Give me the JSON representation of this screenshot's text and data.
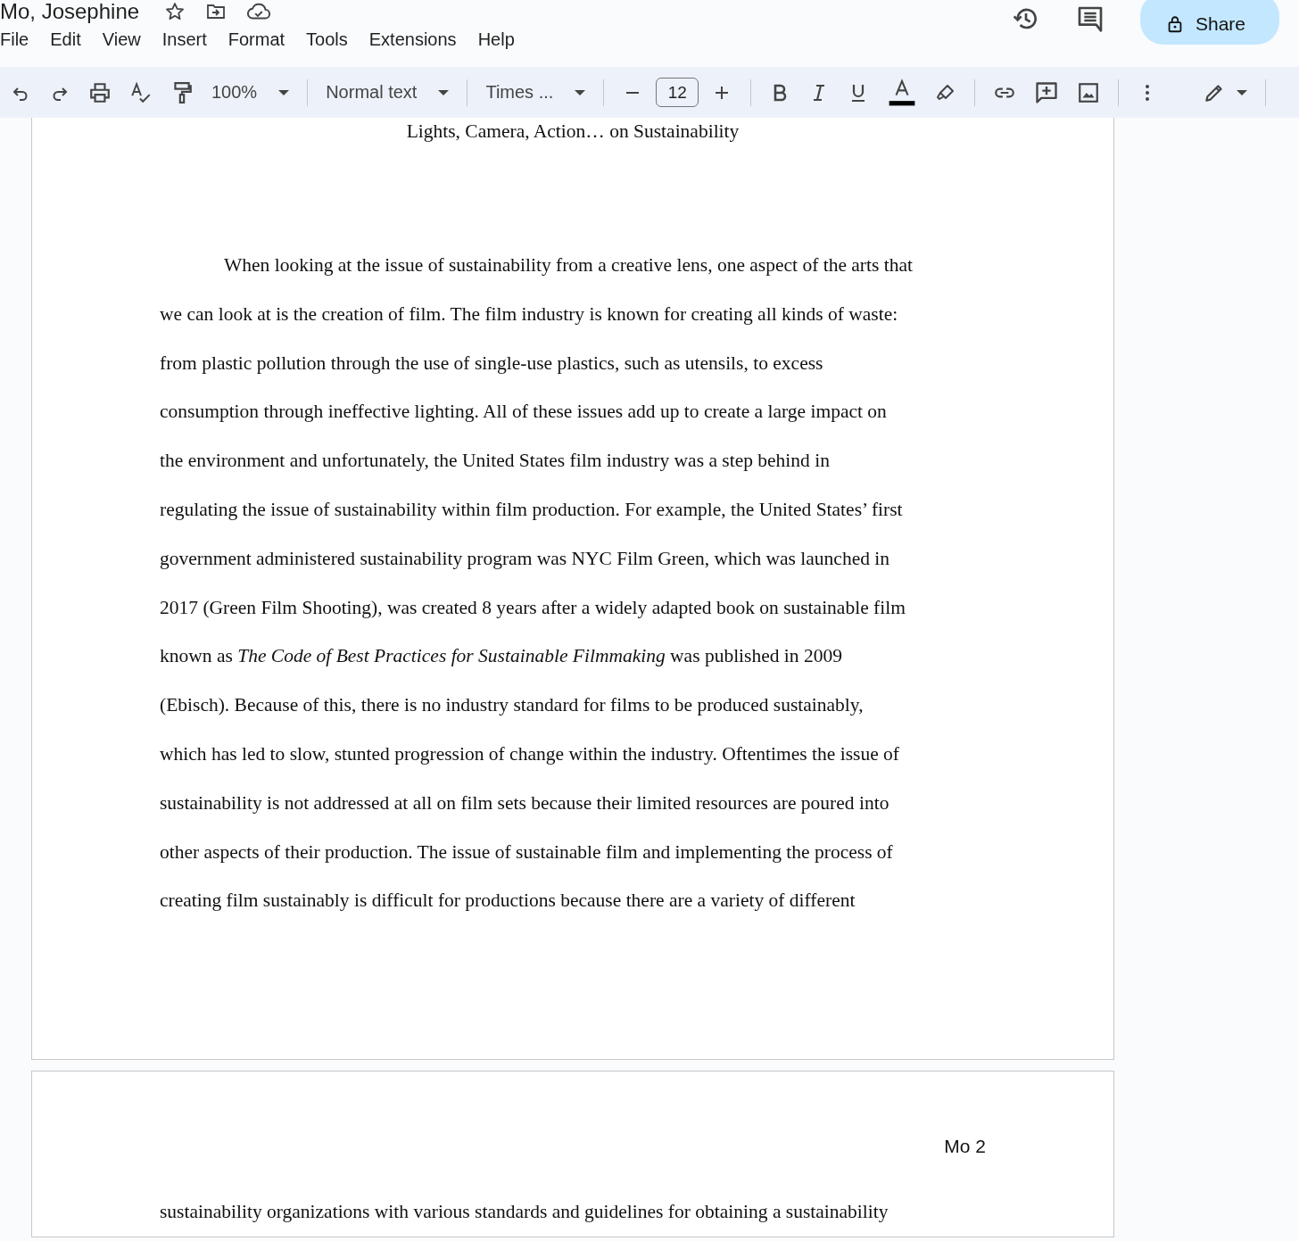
{
  "document": {
    "title": "Mo, Josephine"
  },
  "menu": [
    "File",
    "Edit",
    "View",
    "Insert",
    "Format",
    "Tools",
    "Extensions",
    "Help"
  ],
  "share_button": {
    "label": "Share"
  },
  "toolbar": {
    "zoom": "100%",
    "paragraph_style": "Normal text",
    "font": "Times ...",
    "font_size": "12"
  },
  "pages": [
    {
      "heading": "Lights, Camera, Action… on Sustainability",
      "lines": [
        {
          "text": "When looking at the issue of sustainability from a creative lens, one aspect of the arts that",
          "indent": true
        },
        {
          "text": "we can look at is the creation of film. The film industry is known for creating all kinds of waste:",
          "indent": false
        },
        {
          "text": "from plastic pollution through the use of single-use plastics, such as utensils, to excess",
          "indent": false
        },
        {
          "text": "consumption through ineffective lighting. All of these issues add up to create a large impact on",
          "indent": false
        },
        {
          "text": "the environment and unfortunately, the United States film industry was a step behind in",
          "indent": false
        },
        {
          "text": "regulating the issue of sustainability within film production. For example, the United States’ first",
          "indent": false
        },
        {
          "text": "government administered sustainability program was NYC Film Green, which was launched in",
          "indent": false
        },
        {
          "text": "2017 (Green Film Shooting), was created 8 years after a widely adapted book on sustainable film",
          "indent": false
        },
        {
          "text": "known as *The Code of Best Practices for Sustainable Filmmaking* was published in 2009",
          "indent": false
        },
        {
          "text": "(Ebisch). Because of this, there is no industry standard for films to be produced sustainably,",
          "indent": false
        },
        {
          "text": "which has led to slow, stunted progression of change within the industry. Oftentimes the issue of",
          "indent": false
        },
        {
          "text": "sustainability is not addressed at all on film sets because their limited resources are poured into",
          "indent": false
        },
        {
          "text": "other aspects of their production. The issue of sustainable film and implementing the process of",
          "indent": false
        },
        {
          "text": "creating film sustainably is difficult for productions because there are a variety of different",
          "indent": false
        }
      ]
    },
    {
      "header": "Mo 2",
      "lines": [
        {
          "text": "sustainability organizations with various standards and guidelines for obtaining a sustainability",
          "indent": false
        }
      ]
    }
  ]
}
